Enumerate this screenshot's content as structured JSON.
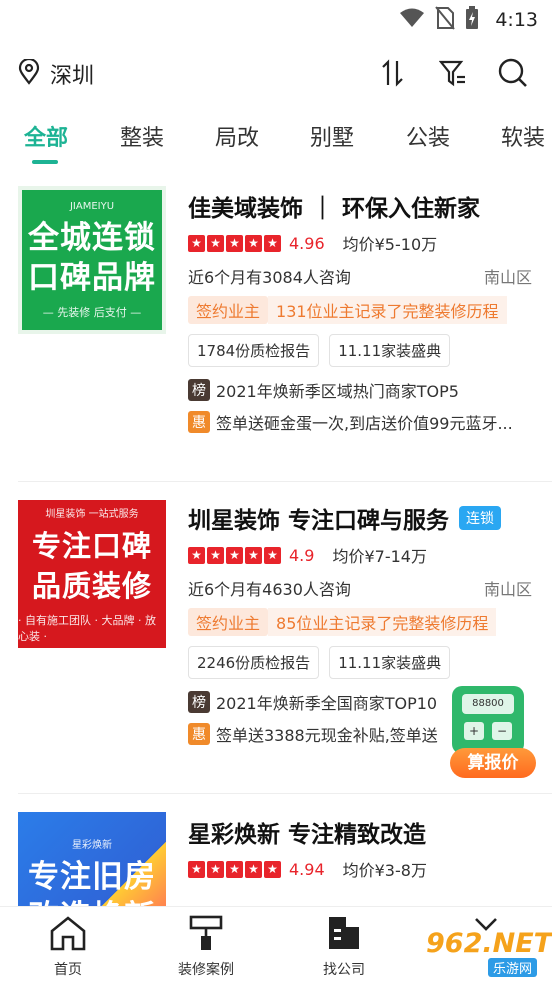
{
  "status_bar": {
    "time": "4:13"
  },
  "header": {
    "city": "深圳",
    "icons": [
      "location-icon",
      "sort-icon",
      "filter-icon",
      "search-icon"
    ]
  },
  "tabs": [
    {
      "label": "全部",
      "active": true
    },
    {
      "label": "整装",
      "active": false
    },
    {
      "label": "局改",
      "active": false
    },
    {
      "label": "别墅",
      "active": false
    },
    {
      "label": "公装",
      "active": false
    },
    {
      "label": "软装",
      "active": false
    }
  ],
  "companies": [
    {
      "thumb": {
        "head": "JIAMEIYU",
        "line1": "全城连锁",
        "line2": "口碑品牌",
        "sub": "— 先装修 后支付 —"
      },
      "name": "佳美域装饰 ｜ 环保入住新家",
      "badge": "",
      "stars": 5,
      "score": "4.96",
      "price": "均价¥5-10万",
      "consult": "近6个月有3084人咨询",
      "district": "南山区",
      "owner_tag": "签约业主",
      "owner_text": "131位业主记录了完整装修历程",
      "chips": [
        "1784份质检报告",
        "11.11家装盛典"
      ],
      "rank_icon": "榜",
      "rank_text": "2021年焕新季区域热门商家TOP5",
      "promo_icon": "惠",
      "promo_text": "签单送砸金蛋一次,到店送价值99元蓝牙..."
    },
    {
      "thumb": {
        "head": "圳星装饰 一站式服务",
        "line1": "专注口碑",
        "line2": "品质装修",
        "sub": "· 自有施工团队 · 大品牌 · 放心装 ·"
      },
      "name": "圳星装饰 专注口碑与服务",
      "badge": "连锁",
      "stars": 5,
      "score": "4.9",
      "price": "均价¥7-14万",
      "consult": "近6个月有4630人咨询",
      "district": "南山区",
      "owner_tag": "签约业主",
      "owner_text": "85位业主记录了完整装修历程",
      "chips": [
        "2246份质检报告",
        "11.11家装盛典"
      ],
      "rank_icon": "榜",
      "rank_text": "2021年焕新季全国商家TOP10",
      "promo_icon": "惠",
      "promo_text": "签单送3388元现金补贴,签单送"
    },
    {
      "thumb": {
        "head": "星彩焕新",
        "line1": "专注旧房",
        "line2": "改造焕新",
        "sub": ""
      },
      "name": "星彩焕新 专注精致改造",
      "badge": "",
      "stars": 5,
      "score": "4.94",
      "price": "均价¥3-8万"
    }
  ],
  "float_calc": {
    "screen": "88800",
    "label": "算报价"
  },
  "bottom_nav": [
    {
      "label": "首页",
      "icon": "home-icon"
    },
    {
      "label": "装修案例",
      "icon": "paint-roller-icon"
    },
    {
      "label": "找公司",
      "icon": "building-icon"
    },
    {
      "label": "",
      "icon": "gift-icon"
    }
  ],
  "watermark": {
    "big": "962.NET",
    "small": "乐游网"
  },
  "colors": {
    "accent": "#1db394",
    "rating": "#e8242b",
    "owner": "#ee7a30",
    "chain": "#2aa7f2"
  }
}
